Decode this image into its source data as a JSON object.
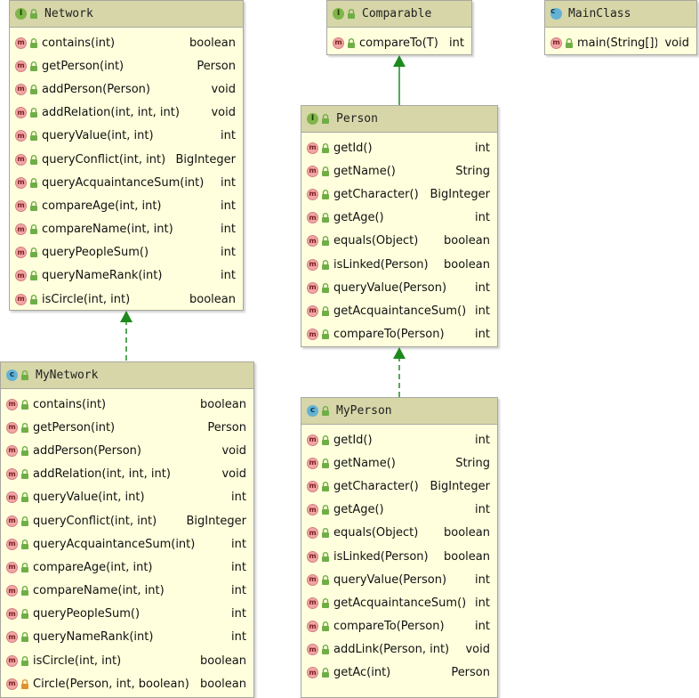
{
  "colors": {
    "box_fill": "#ffffdd",
    "header_fill": "#d6d6a8",
    "border": "#a8a8a0",
    "edge": "#1e8a1e",
    "public_lock": "#6fae46",
    "private_lock": "#e0912c"
  },
  "icons": {
    "interface": "I",
    "class": "c",
    "method": "m"
  },
  "classes": {
    "network": {
      "name": "Network",
      "methods": [
        {
          "name": "contains(int)",
          "type": "boolean"
        },
        {
          "name": "getPerson(int)",
          "type": "Person"
        },
        {
          "name": "addPerson(Person)",
          "type": "void"
        },
        {
          "name": "addRelation(int, int, int)",
          "type": "void"
        },
        {
          "name": "queryValue(int, int)",
          "type": "int"
        },
        {
          "name": "queryConflict(int, int)",
          "type": "BigInteger"
        },
        {
          "name": "queryAcquaintanceSum(int)",
          "type": "int"
        },
        {
          "name": "compareAge(int, int)",
          "type": "int"
        },
        {
          "name": "compareName(int, int)",
          "type": "int"
        },
        {
          "name": "queryPeopleSum()",
          "type": "int"
        },
        {
          "name": "queryNameRank(int)",
          "type": "int"
        },
        {
          "name": "isCircle(int, int)",
          "type": "boolean"
        }
      ]
    },
    "comparable": {
      "name": "Comparable",
      "methods": [
        {
          "name": "compareTo(T)",
          "type": "int"
        }
      ]
    },
    "mainclass": {
      "name": "MainClass",
      "methods": [
        {
          "name": "main(String[])",
          "type": "void"
        }
      ]
    },
    "person": {
      "name": "Person",
      "methods": [
        {
          "name": "getId()",
          "type": "int"
        },
        {
          "name": "getName()",
          "type": "String"
        },
        {
          "name": "getCharacter()",
          "type": "BigInteger"
        },
        {
          "name": "getAge()",
          "type": "int"
        },
        {
          "name": "equals(Object)",
          "type": "boolean"
        },
        {
          "name": "isLinked(Person)",
          "type": "boolean"
        },
        {
          "name": "queryValue(Person)",
          "type": "int"
        },
        {
          "name": "getAcquaintanceSum()",
          "type": "int"
        },
        {
          "name": "compareTo(Person)",
          "type": "int"
        }
      ]
    },
    "mynetwork": {
      "name": "MyNetwork",
      "methods": [
        {
          "name": "contains(int)",
          "type": "boolean"
        },
        {
          "name": "getPerson(int)",
          "type": "Person"
        },
        {
          "name": "addPerson(Person)",
          "type": "void"
        },
        {
          "name": "addRelation(int, int, int)",
          "type": "void"
        },
        {
          "name": "queryValue(int, int)",
          "type": "int"
        },
        {
          "name": "queryConflict(int, int)",
          "type": "BigInteger"
        },
        {
          "name": "queryAcquaintanceSum(int)",
          "type": "int"
        },
        {
          "name": "compareAge(int, int)",
          "type": "int"
        },
        {
          "name": "compareName(int, int)",
          "type": "int"
        },
        {
          "name": "queryPeopleSum()",
          "type": "int"
        },
        {
          "name": "queryNameRank(int)",
          "type": "int"
        },
        {
          "name": "isCircle(int, int)",
          "type": "boolean"
        },
        {
          "name": "Circle(Person, int, boolean)",
          "type": "boolean",
          "private": true
        }
      ]
    },
    "myperson": {
      "name": "MyPerson",
      "methods": [
        {
          "name": "getId()",
          "type": "int"
        },
        {
          "name": "getName()",
          "type": "String"
        },
        {
          "name": "getCharacter()",
          "type": "BigInteger"
        },
        {
          "name": "getAge()",
          "type": "int"
        },
        {
          "name": "equals(Object)",
          "type": "boolean"
        },
        {
          "name": "isLinked(Person)",
          "type": "boolean"
        },
        {
          "name": "queryValue(Person)",
          "type": "int"
        },
        {
          "name": "getAcquaintanceSum()",
          "type": "int"
        },
        {
          "name": "compareTo(Person)",
          "type": "int"
        },
        {
          "name": "addLink(Person, int)",
          "type": "void"
        },
        {
          "name": "getAc(int)",
          "type": "Person"
        }
      ]
    }
  }
}
